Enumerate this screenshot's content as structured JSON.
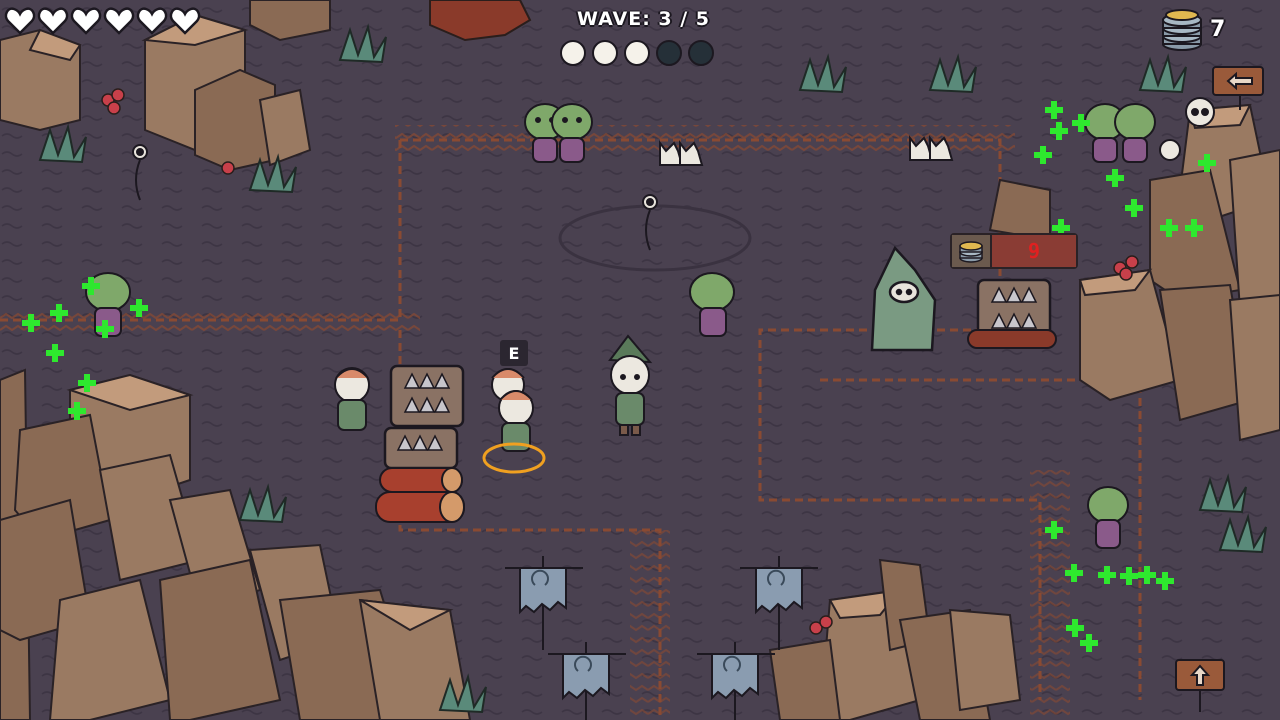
{
  "hud": {
    "lives": {
      "current": 6,
      "max": 6,
      "icon": "heart-icon"
    },
    "wave": {
      "label": "WAVE: 3 / 5",
      "current": 3,
      "total": 5,
      "completed_dots": 3
    },
    "coins": {
      "count": "7",
      "icon": "coin-stack-icon"
    }
  },
  "interaction": {
    "key": "E"
  },
  "shop": {
    "price": "9",
    "item": "spike-trap"
  },
  "colors": {
    "ground": "#4a4150",
    "path_border": "#8a4a32",
    "rock": "#9a7a62",
    "rock_shade": "#6b5244",
    "goblin": "#7fa86a",
    "heal_particle": "#2ee82e",
    "price_red": "#e02020"
  }
}
